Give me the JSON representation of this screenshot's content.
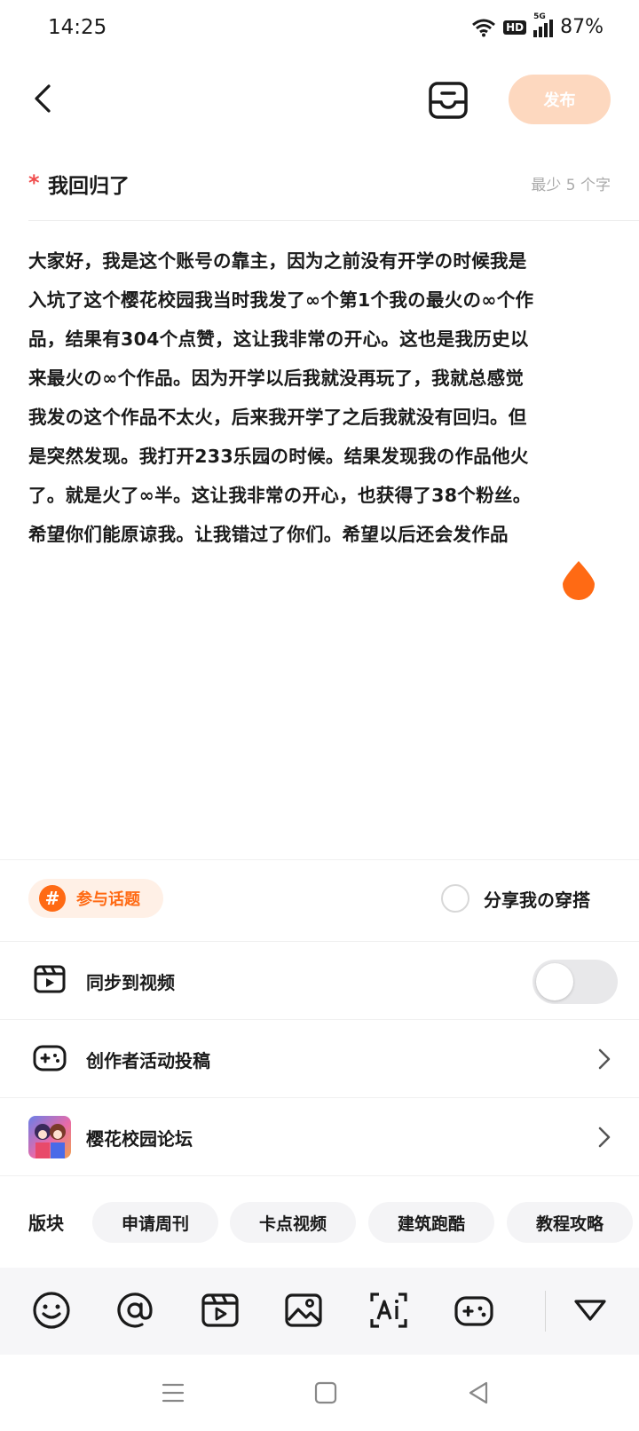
{
  "status_bar": {
    "time": "14:25",
    "hd": "HD",
    "network": "5G",
    "battery": "87%"
  },
  "header": {
    "publish_label": "发布"
  },
  "title": {
    "text": "我回归了",
    "min_hint": "最少  5  个字"
  },
  "body_lines": [
    "大家好，我是这个账号の靠主，因为之前没有开学の时候我是",
    "入坑了这个樱花校园我当时我发了∞个第1个我の最火の∞个作",
    "品，结果有304个点赞，这让我非常の开心。这也是我历史以",
    "来最火の∞个作品。因为开学以后我就没再玩了，我就总感觉",
    "我发の这个作品不太火，后来我开学了之后我就没有回归。但",
    "是突然发现。我打开233乐园の时候。结果发现我の作品他火",
    "了。就是火了∞半。这让我非常の开心，也获得了38个粉丝。",
    "希望你们能原谅我。让我错过了你们。希望以后还会发作品"
  ],
  "topic": {
    "hash": "#",
    "label": "参与话题"
  },
  "share": {
    "label": "分享我の穿搭"
  },
  "rows": {
    "sync_video": "同步到视频",
    "creator_activity": "创作者活动投稿",
    "forum": "樱花校园论坛"
  },
  "sections": {
    "label": "版块",
    "chips": [
      "申请周刊",
      "卡点视频",
      "建筑跑酷",
      "教程攻略"
    ]
  },
  "colors": {
    "accent": "#ff6a14",
    "publish_disabled": "#fdd8bf",
    "required": "#f04c4c"
  },
  "icons": {
    "toolbar": [
      "emoji-icon",
      "at-mention-icon",
      "video-icon",
      "image-icon",
      "ai-icon",
      "game-icon",
      "collapse-icon"
    ]
  }
}
